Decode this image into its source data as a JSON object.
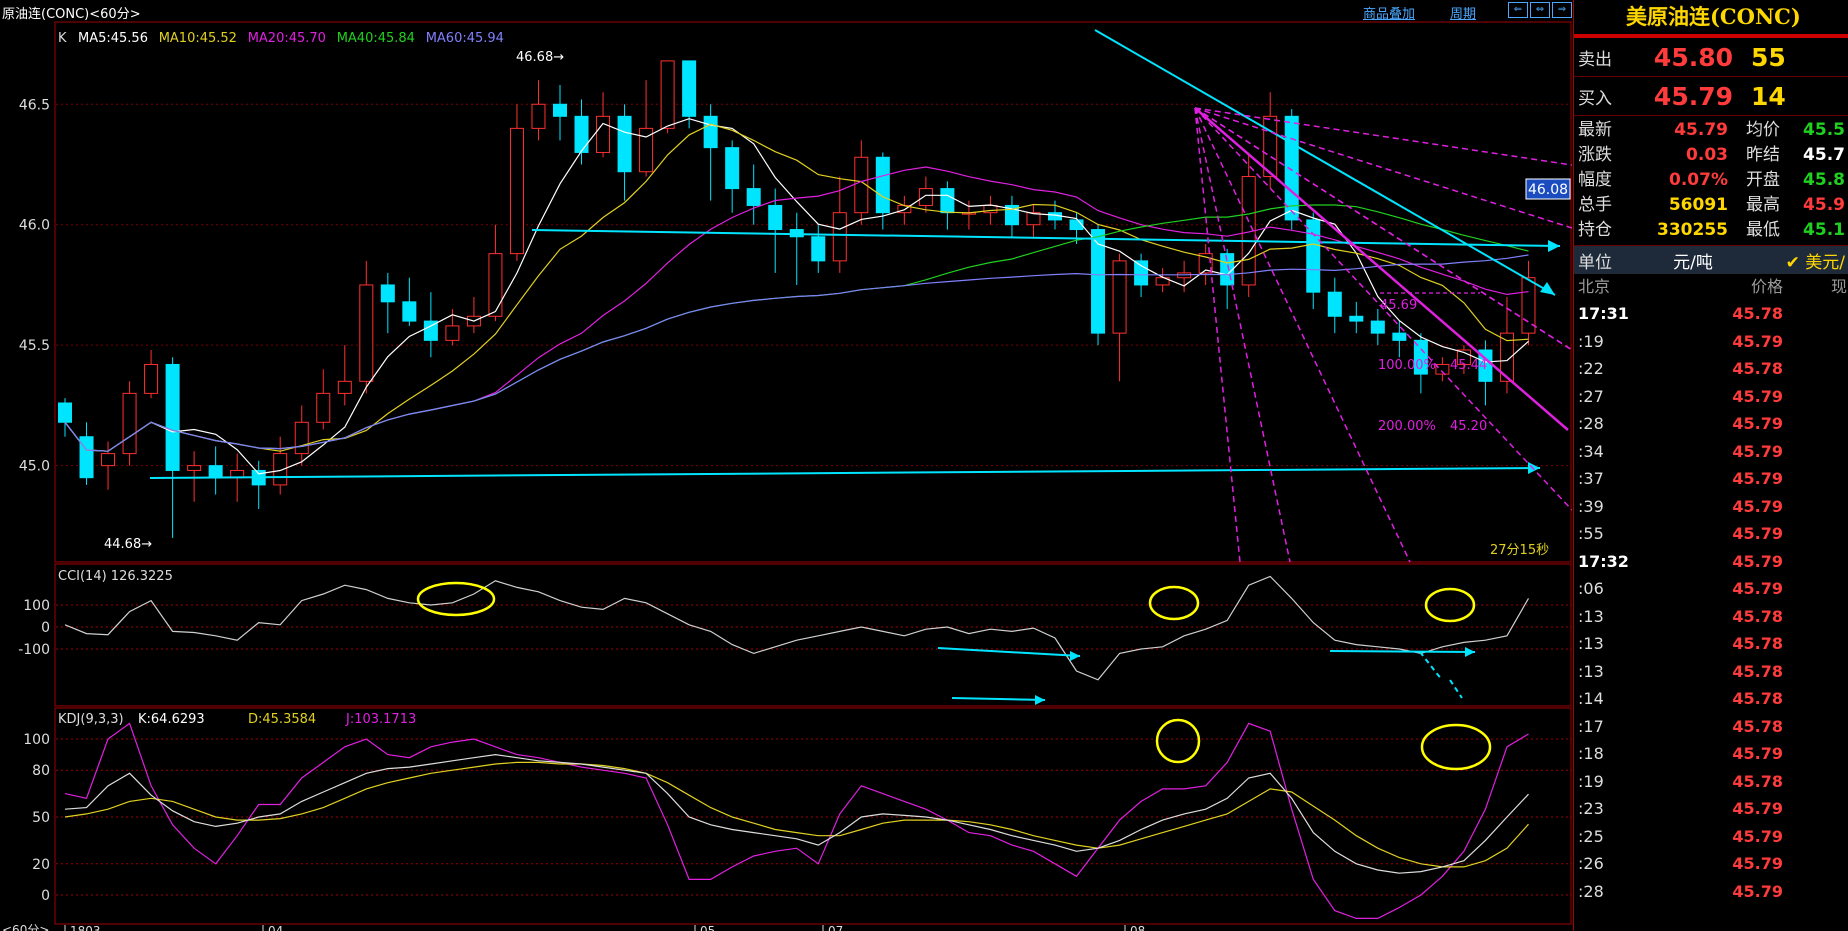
{
  "window": {
    "title": "原油连(CONC)<60分>",
    "link_overlay": "商品叠加",
    "link_period": "周期",
    "win_buttons": [
      "⇐",
      "⇔",
      "⇒",
      "▯"
    ]
  },
  "main_panel": {
    "legend_prefix": "K",
    "ma_labels": [
      {
        "text": "MA5:45.56",
        "color": "#ffffff"
      },
      {
        "text": "MA10:45.52",
        "color": "#e0d020"
      },
      {
        "text": "MA20:45.70",
        "color": "#e020e0"
      },
      {
        "text": "MA40:45.84",
        "color": "#20d020"
      },
      {
        "text": "MA60:45.94",
        "color": "#8080ff"
      }
    ],
    "price_axis": [
      "46.5",
      "46.0",
      "45.5",
      "45.0"
    ],
    "high_marker": "46.68",
    "low_marker": "44.68",
    "price_tag": "46.08",
    "fib_labels": [
      {
        "text": "45.69",
        "color": "#e020e0"
      },
      {
        "text": "100.00%",
        "color": "#e020e0"
      },
      {
        "text": "45.44",
        "color": "#e020e0"
      },
      {
        "text": "200.00%",
        "color": "#e020e0"
      },
      {
        "text": "45.20",
        "color": "#e020e0"
      }
    ],
    "countdown": "27分15秒"
  },
  "cci_panel": {
    "label": "CCI(14)",
    "value": "126.3225",
    "axis": [
      "100",
      "0",
      "-100"
    ]
  },
  "kdj_panel": {
    "label": "KDJ(9,3,3)",
    "k_text": "K:64.6293",
    "d_text": "D:45.3584",
    "j_text": "J:103.1713",
    "axis": [
      "100",
      "80",
      "50",
      "20",
      "0"
    ]
  },
  "date_axis": {
    "prefix": "<60分>",
    "labels": [
      "1803",
      "04",
      "05",
      "07",
      "08"
    ]
  },
  "chart_data": {
    "type": "candlestick",
    "x_unit": "60-minute bars",
    "y_unit": "USD per barrel",
    "y_range": [
      44.6,
      46.8
    ],
    "candles": [
      [
        45.26,
        45.18,
        45.28,
        45.12
      ],
      [
        45.12,
        44.95,
        45.18,
        44.92
      ],
      [
        45.0,
        45.05,
        45.1,
        44.9
      ],
      [
        45.05,
        45.3,
        45.35,
        45.0
      ],
      [
        45.3,
        45.42,
        45.48,
        45.28
      ],
      [
        45.42,
        44.98,
        45.45,
        44.7
      ],
      [
        44.98,
        45.0,
        45.06,
        44.85
      ],
      [
        45.0,
        44.95,
        45.08,
        44.88
      ],
      [
        44.95,
        44.98,
        45.05,
        44.85
      ],
      [
        44.98,
        44.92,
        45.02,
        44.82
      ],
      [
        44.92,
        45.05,
        45.12,
        44.88
      ],
      [
        45.05,
        45.18,
        45.25,
        45.0
      ],
      [
        45.18,
        45.3,
        45.4,
        45.15
      ],
      [
        45.3,
        45.35,
        45.5,
        45.25
      ],
      [
        45.35,
        45.75,
        45.85,
        45.3
      ],
      [
        45.75,
        45.68,
        45.8,
        45.55
      ],
      [
        45.68,
        45.6,
        45.78,
        45.58
      ],
      [
        45.6,
        45.52,
        45.72,
        45.45
      ],
      [
        45.52,
        45.58,
        45.65,
        45.5
      ],
      [
        45.58,
        45.62,
        45.7,
        45.55
      ],
      [
        45.62,
        45.88,
        46.0,
        45.6
      ],
      [
        45.88,
        46.4,
        46.5,
        45.85
      ],
      [
        46.4,
        46.5,
        46.6,
        46.35
      ],
      [
        46.5,
        46.45,
        46.58,
        46.35
      ],
      [
        46.45,
        46.3,
        46.52,
        46.25
      ],
      [
        46.3,
        46.45,
        46.55,
        46.28
      ],
      [
        46.45,
        46.22,
        46.5,
        46.1
      ],
      [
        46.22,
        46.4,
        46.6,
        46.2
      ],
      [
        46.4,
        46.68,
        46.68,
        46.38
      ],
      [
        46.68,
        46.45,
        46.68,
        46.4
      ],
      [
        46.45,
        46.32,
        46.5,
        46.1
      ],
      [
        46.32,
        46.15,
        46.35,
        46.05
      ],
      [
        46.15,
        46.08,
        46.25,
        46.0
      ],
      [
        46.08,
        45.98,
        46.15,
        45.8
      ],
      [
        45.98,
        45.95,
        46.05,
        45.75
      ],
      [
        45.95,
        45.85,
        46.0,
        45.8
      ],
      [
        45.85,
        46.05,
        46.2,
        45.8
      ],
      [
        46.05,
        46.28,
        46.35,
        46.0
      ],
      [
        46.28,
        46.05,
        46.3,
        45.98
      ],
      [
        46.05,
        46.08,
        46.12,
        46.0
      ],
      [
        46.08,
        46.15,
        46.2,
        46.05
      ],
      [
        46.15,
        46.05,
        46.18,
        45.98
      ],
      [
        46.05,
        46.05,
        46.1,
        45.98
      ],
      [
        46.05,
        46.08,
        46.12,
        46.0
      ],
      [
        46.08,
        46.0,
        46.12,
        45.95
      ],
      [
        46.0,
        46.05,
        46.08,
        45.95
      ],
      [
        46.05,
        46.02,
        46.1,
        45.98
      ],
      [
        46.02,
        45.98,
        46.05,
        45.92
      ],
      [
        45.98,
        45.55,
        46.0,
        45.5
      ],
      [
        45.55,
        45.85,
        45.88,
        45.35
      ],
      [
        45.85,
        45.75,
        45.88,
        45.7
      ],
      [
        45.75,
        45.78,
        45.82,
        45.72
      ],
      [
        45.78,
        45.8,
        45.85,
        45.72
      ],
      [
        45.8,
        45.88,
        45.92,
        45.75
      ],
      [
        45.88,
        45.75,
        45.9,
        45.65
      ],
      [
        45.75,
        46.2,
        46.3,
        45.7
      ],
      [
        46.2,
        46.45,
        46.55,
        46.15
      ],
      [
        46.45,
        46.02,
        46.48,
        45.98
      ],
      [
        46.02,
        45.72,
        46.05,
        45.65
      ],
      [
        45.72,
        45.62,
        45.78,
        45.55
      ],
      [
        45.62,
        45.6,
        45.68,
        45.55
      ],
      [
        45.6,
        45.55,
        45.65,
        45.5
      ],
      [
        45.55,
        45.52,
        45.6,
        45.45
      ],
      [
        45.52,
        45.38,
        45.55,
        45.3
      ],
      [
        45.38,
        45.42,
        45.45,
        45.35
      ],
      [
        45.42,
        45.48,
        45.5,
        45.38
      ],
      [
        45.48,
        45.35,
        45.52,
        45.25
      ],
      [
        45.35,
        45.55,
        45.7,
        45.3
      ],
      [
        45.55,
        45.78,
        45.85,
        45.5
      ]
    ],
    "cci_series": [
      10,
      -30,
      -35,
      70,
      120,
      -20,
      -25,
      -40,
      -60,
      20,
      10,
      120,
      150,
      190,
      170,
      130,
      110,
      100,
      110,
      150,
      210,
      180,
      160,
      120,
      90,
      80,
      130,
      110,
      60,
      10,
      -20,
      -80,
      -120,
      -90,
      -60,
      -40,
      -20,
      0,
      -20,
      -40,
      -10,
      0,
      -30,
      -10,
      -20,
      -5,
      -50,
      -200,
      -240,
      -120,
      -100,
      -90,
      -40,
      -10,
      30,
      190,
      230,
      130,
      20,
      -60,
      -80,
      -90,
      -100,
      -120,
      -90,
      -70,
      -60,
      -40,
      130
    ],
    "kdj_k": [
      55,
      56,
      70,
      78,
      64,
      54,
      47,
      44,
      46,
      50,
      52,
      60,
      66,
      72,
      78,
      81,
      82,
      84,
      86,
      88,
      90,
      88,
      86,
      85,
      84,
      82,
      80,
      78,
      65,
      50,
      45,
      42,
      40,
      38,
      36,
      32,
      40,
      50,
      52,
      51,
      50,
      48,
      45,
      42,
      38,
      35,
      32,
      28,
      30,
      35,
      42,
      48,
      52,
      55,
      62,
      75,
      78,
      62,
      40,
      28,
      20,
      16,
      14,
      15,
      18,
      22,
      35,
      50,
      64.6
    ],
    "kdj_d": [
      50,
      52,
      55,
      60,
      62,
      60,
      55,
      50,
      48,
      48,
      49,
      52,
      56,
      62,
      68,
      72,
      75,
      78,
      80,
      82,
      84,
      85,
      85,
      84,
      84,
      83,
      81,
      78,
      72,
      64,
      56,
      50,
      46,
      42,
      40,
      38,
      38,
      42,
      46,
      48,
      48,
      48,
      47,
      45,
      42,
      38,
      35,
      32,
      30,
      32,
      36,
      40,
      44,
      48,
      52,
      60,
      68,
      66,
      57,
      48,
      38,
      30,
      24,
      20,
      18,
      18,
      22,
      30,
      45.4
    ],
    "kdj_j": [
      65,
      62,
      100,
      110,
      70,
      45,
      30,
      20,
      38,
      58,
      58,
      75,
      85,
      95,
      100,
      90,
      88,
      95,
      98,
      100,
      95,
      90,
      88,
      85,
      82,
      80,
      78,
      75,
      45,
      10,
      10,
      18,
      25,
      28,
      30,
      20,
      52,
      70,
      65,
      60,
      55,
      48,
      40,
      38,
      32,
      28,
      20,
      12,
      30,
      48,
      60,
      68,
      68,
      70,
      85,
      110,
      105,
      55,
      10,
      -10,
      -15,
      -15,
      -8,
      0,
      12,
      28,
      55,
      95,
      103.2
    ]
  },
  "side": {
    "title": "美原油连(CONC)",
    "ask": {
      "label": "卖出",
      "price": "45.80",
      "volume": "55"
    },
    "bid": {
      "label": "买入",
      "price": "45.79",
      "volume": "14"
    },
    "stats": [
      {
        "k": "最新",
        "v": "45.79",
        "vc": "#ff3b3b",
        "k2": "均价",
        "v2": "45.5",
        "v2c": "#20d020"
      },
      {
        "k": "涨跌",
        "v": "0.03",
        "vc": "#ff3b3b",
        "k2": "昨结",
        "v2": "45.7",
        "v2c": "#ffffff"
      },
      {
        "k": "幅度",
        "v": "0.07%",
        "vc": "#ff3b3b",
        "k2": "开盘",
        "v2": "45.8",
        "v2c": "#20d020"
      },
      {
        "k": "总手",
        "v": "56091",
        "vc": "#ffd700",
        "k2": "最高",
        "v2": "45.9",
        "v2c": "#ff3b3b"
      },
      {
        "k": "持仓",
        "v": "330255",
        "vc": "#ffd700",
        "k2": "最低",
        "v2": "45.1",
        "v2c": "#20d020"
      }
    ],
    "unit_label": "单位",
    "unit_value": "元/吨",
    "unit_currency": "✔ 美元/",
    "ticks_head": [
      "北京",
      "价格",
      "现"
    ],
    "ticks": [
      {
        "t": "17:31",
        "p": "45.78",
        "bold": true
      },
      {
        "t": ":19",
        "p": "45.79"
      },
      {
        "t": ":22",
        "p": "45.78"
      },
      {
        "t": ":27",
        "p": "45.79"
      },
      {
        "t": ":28",
        "p": "45.79"
      },
      {
        "t": ":34",
        "p": "45.79"
      },
      {
        "t": ":37",
        "p": "45.79"
      },
      {
        "t": ":39",
        "p": "45.79"
      },
      {
        "t": ":55",
        "p": "45.79"
      },
      {
        "t": "17:32",
        "p": "45.79",
        "bold": true
      },
      {
        "t": ":06",
        "p": "45.79"
      },
      {
        "t": ":13",
        "p": "45.78"
      },
      {
        "t": ":13",
        "p": "45.78"
      },
      {
        "t": ":13",
        "p": "45.78"
      },
      {
        "t": ":14",
        "p": "45.78"
      },
      {
        "t": ":17",
        "p": "45.78"
      },
      {
        "t": ":18",
        "p": "45.79"
      },
      {
        "t": ":19",
        "p": "45.78"
      },
      {
        "t": ":23",
        "p": "45.79"
      },
      {
        "t": ":25",
        "p": "45.79"
      },
      {
        "t": ":26",
        "p": "45.79"
      },
      {
        "t": ":28",
        "p": "45.79"
      }
    ]
  }
}
